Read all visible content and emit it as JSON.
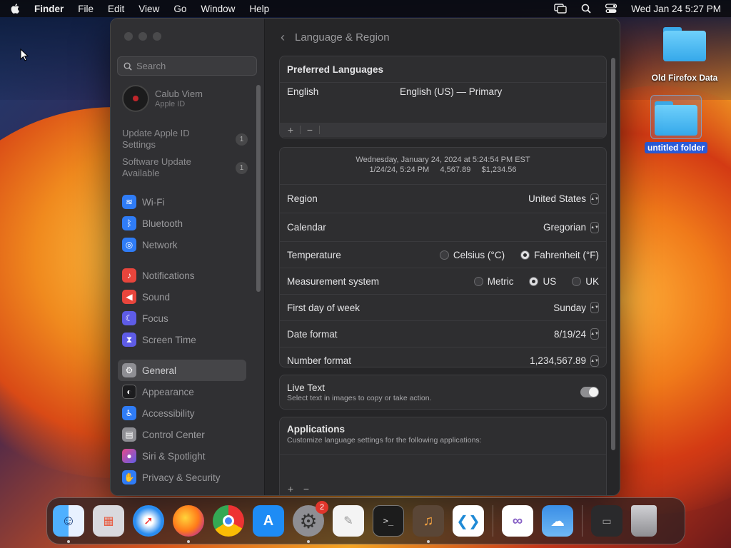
{
  "menubar": {
    "app_name": "Finder",
    "items": [
      "File",
      "Edit",
      "View",
      "Go",
      "Window",
      "Help"
    ],
    "clock": "Wed Jan 24  5:27 PM"
  },
  "desktop": {
    "icons": [
      {
        "label": "Old Firefox Data"
      },
      {
        "label": "untitled folder"
      }
    ]
  },
  "sidebar": {
    "search_placeholder": "Search",
    "account": {
      "name": "Calub Viem",
      "subtitle": "Apple ID"
    },
    "notices": [
      {
        "label": "Update Apple ID Settings",
        "badge": "1"
      },
      {
        "label": "Software Update Available",
        "badge": "1"
      }
    ],
    "items": [
      {
        "label": "Wi-Fi",
        "icon": "wifi-icon",
        "color": "#2f7cf6"
      },
      {
        "label": "Bluetooth",
        "icon": "bluetooth-icon",
        "color": "#2f7cf6"
      },
      {
        "label": "Network",
        "icon": "globe-icon",
        "color": "#2f7cf6"
      },
      {
        "label": "Notifications",
        "icon": "bell-icon",
        "color": "#e8453c"
      },
      {
        "label": "Sound",
        "icon": "speaker-icon",
        "color": "#e8453c"
      },
      {
        "label": "Focus",
        "icon": "moon-icon",
        "color": "#5e5ce6"
      },
      {
        "label": "Screen Time",
        "icon": "hourglass-icon",
        "color": "#5e5ce6"
      },
      {
        "label": "General",
        "icon": "gear-icon",
        "color": "#8e8e93"
      },
      {
        "label": "Appearance",
        "icon": "appearance-icon",
        "color": "#1c1c1e"
      },
      {
        "label": "Accessibility",
        "icon": "accessibility-icon",
        "color": "#2f7cf6"
      },
      {
        "label": "Control Center",
        "icon": "control-center-icon",
        "color": "#8e8e93"
      },
      {
        "label": "Siri & Spotlight",
        "icon": "siri-icon",
        "color": "#b03ad6"
      },
      {
        "label": "Privacy & Security",
        "icon": "hand-icon",
        "color": "#2f7cf6"
      }
    ]
  },
  "main": {
    "title": "Language & Region",
    "preferred_languages": {
      "heading": "Preferred Languages",
      "language": "English",
      "detail": "English (US) — Primary"
    },
    "preview": {
      "line1": "Wednesday, January 24, 2024 at 5:24:54 PM EST",
      "line2": "1/24/24, 5:24 PM     4,567.89     $1,234.56"
    },
    "settings": {
      "region": {
        "label": "Region",
        "value": "United States"
      },
      "calendar": {
        "label": "Calendar",
        "value": "Gregorian"
      },
      "temperature": {
        "label": "Temperature",
        "options": [
          "Celsius (°C)",
          "Fahrenheit (°F)"
        ],
        "selected": "Fahrenheit (°F)"
      },
      "measurement": {
        "label": "Measurement system",
        "options": [
          "Metric",
          "US",
          "UK"
        ],
        "selected": "US"
      },
      "first_day": {
        "label": "First day of week",
        "value": "Sunday"
      },
      "date_format": {
        "label": "Date format",
        "value": "8/19/24"
      },
      "number_format": {
        "label": "Number format",
        "value": "1,234,567.89"
      }
    },
    "live_text": {
      "label": "Live Text",
      "description": "Select text in images to copy or take action.",
      "enabled": true
    },
    "applications": {
      "heading": "Applications",
      "description": "Customize language settings for the following applications:"
    }
  },
  "dock": {
    "apps": [
      {
        "name": "Finder",
        "icon": "finder-icon",
        "color": "#3b8ff3",
        "running": true
      },
      {
        "name": "Launchpad",
        "icon": "launchpad-icon",
        "color": "#d9d9de",
        "running": false
      },
      {
        "name": "Safari",
        "icon": "safari-icon",
        "color": "#2a8cf0",
        "running": false
      },
      {
        "name": "Firefox",
        "icon": "firefox-icon",
        "color": "#ff7a1a",
        "running": true
      },
      {
        "name": "Chrome",
        "icon": "chrome-icon",
        "color": "#ffffff",
        "running": false
      },
      {
        "name": "App Store",
        "icon": "app-store-icon",
        "color": "#1e8cf5",
        "running": false
      },
      {
        "name": "System Settings",
        "icon": "settings-icon",
        "color": "#8e8e93",
        "running": true,
        "badge": "2"
      },
      {
        "name": "TextEdit",
        "icon": "textedit-icon",
        "color": "#f4f4f4",
        "running": false
      },
      {
        "name": "Terminal",
        "icon": "terminal-icon",
        "color": "#1c1c1c",
        "running": false
      },
      {
        "name": "GarageBand",
        "icon": "guitar-icon",
        "color": "#5a4636",
        "running": true
      },
      {
        "name": "VS Code",
        "icon": "vscode-icon",
        "color": "#ffffff",
        "running": false
      },
      {
        "name": "Visual Studio",
        "icon": "visual-studio-icon",
        "color": "#ffffff",
        "running": false
      },
      {
        "name": "Weather",
        "icon": "weather-icon",
        "color": "#3a8ee6",
        "running": false
      },
      {
        "name": "Downloads",
        "icon": "downloads-stack-icon",
        "color": "#2a2a2c",
        "running": false
      },
      {
        "name": "Trash",
        "icon": "trash-icon",
        "color": "#b0b0b4",
        "running": false
      }
    ]
  }
}
